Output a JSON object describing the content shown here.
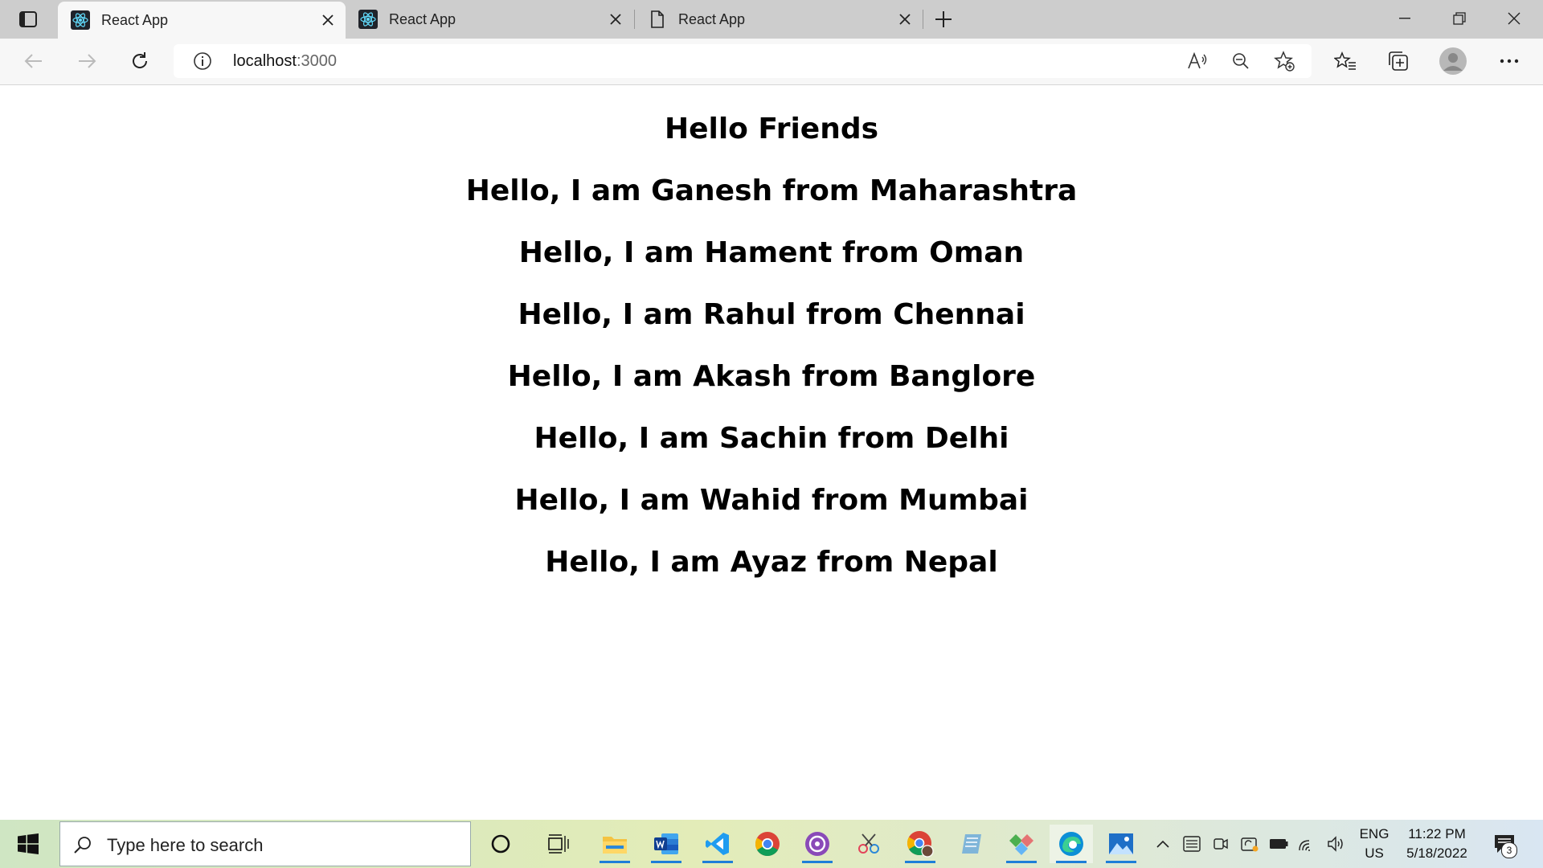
{
  "browser": {
    "tabs": [
      {
        "label": "React App",
        "favicon": "react-logo-icon",
        "active": true
      },
      {
        "label": "React App",
        "favicon": "react-logo-icon",
        "active": false
      },
      {
        "label": "React App",
        "favicon": "document-icon",
        "active": false
      }
    ],
    "address": {
      "host": "localhost",
      "port": ":3000"
    }
  },
  "page": {
    "heading": "Hello Friends",
    "greetings": [
      "Hello, I am Ganesh from Maharashtra",
      "Hello, I am Hament from Oman",
      "Hello, I am Rahul from Chennai",
      "Hello, I am Akash from Banglore",
      "Hello, I am Sachin from Delhi",
      "Hello, I am Wahid from Mumbai",
      "Hello, I am Ayaz from Nepal"
    ]
  },
  "taskbar": {
    "search_placeholder": "Type here to search",
    "language": {
      "line1": "ENG",
      "line2": "US"
    },
    "time": "11:22 PM",
    "date": "5/18/2022",
    "notification_count": "3"
  },
  "colors": {
    "accent": "#1e7ed8",
    "react": "#61dafb"
  }
}
